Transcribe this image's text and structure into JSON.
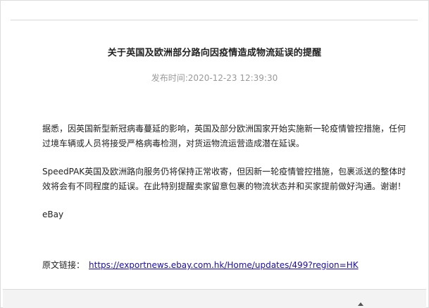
{
  "article": {
    "title": "关于英国及欧洲部分路向因疫情造成物流延误的提醒",
    "publish_time": "发布时间:2020-12-23 12:39:30",
    "paragraphs": [
      "据悉，因英国新型新冠病毒蔓延的影响，英国及部分欧洲国家开始实施新一轮疫情管控措施，任何过境车辆或人员将接受严格病毒检测，对货运物流运营造成潜在延误。",
      "SpeedPAK英国及欧洲路向服务仍将保持正常收寄，但因新一轮疫情管控措施，包裹派送的整体时效将会有不同程度的延误。在此特别提醒卖家留意包裹的物流状态并和买家提前做好沟通。谢谢！",
      "eBay"
    ],
    "source_label": "原文链接：",
    "source_url": "https://exportnews.ebay.com.hk/Home/updates/499?region=HK"
  }
}
